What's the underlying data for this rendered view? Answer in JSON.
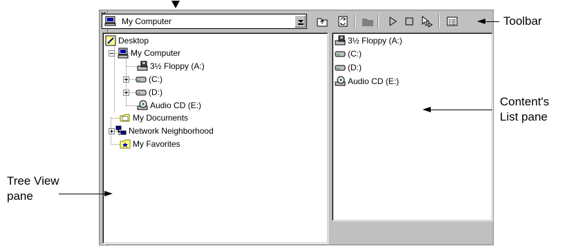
{
  "address_bar": {
    "value": "My Computer"
  },
  "tree": {
    "items": [
      {
        "label": "Desktop",
        "icon": "desktop-icon"
      },
      {
        "label": "My Computer",
        "icon": "my-computer-icon"
      },
      {
        "label": "3½ Floppy (A:)",
        "icon": "floppy-drive-icon"
      },
      {
        "label": "(C:)",
        "icon": "hard-drive-icon"
      },
      {
        "label": "(D:)",
        "icon": "hard-drive-icon"
      },
      {
        "label": "Audio CD (E:)",
        "icon": "cd-drive-icon"
      },
      {
        "label": "My Documents",
        "icon": "folder-icon"
      },
      {
        "label": "Network Neighborhood",
        "icon": "network-icon"
      },
      {
        "label": "My Favorites",
        "icon": "favorites-folder-icon"
      }
    ]
  },
  "content_list": {
    "items": [
      {
        "label": "3½ Floppy (A:)",
        "icon": "floppy-drive-icon"
      },
      {
        "label": "(C:)",
        "icon": "hard-drive-icon"
      },
      {
        "label": "(D:)",
        "icon": "hard-drive-icon"
      },
      {
        "label": "Audio CD (E:)",
        "icon": "cd-drive-icon"
      }
    ]
  },
  "toolbar": {
    "buttons": [
      "up-folder-icon",
      "refresh-icon",
      "folder-icon",
      "play-icon",
      "stop-icon",
      "pointer-icon",
      "properties-icon"
    ]
  },
  "callouts": {
    "toolbar": "Toolbar",
    "content_list_line1": "Content's",
    "content_list_line2": "List pane",
    "tree_view_line1": "Tree View",
    "tree_view_line2": "pane"
  },
  "colors": {
    "window_face": "#c0c0c0",
    "pane_background": "#ffffff",
    "shadow": "#808080"
  }
}
